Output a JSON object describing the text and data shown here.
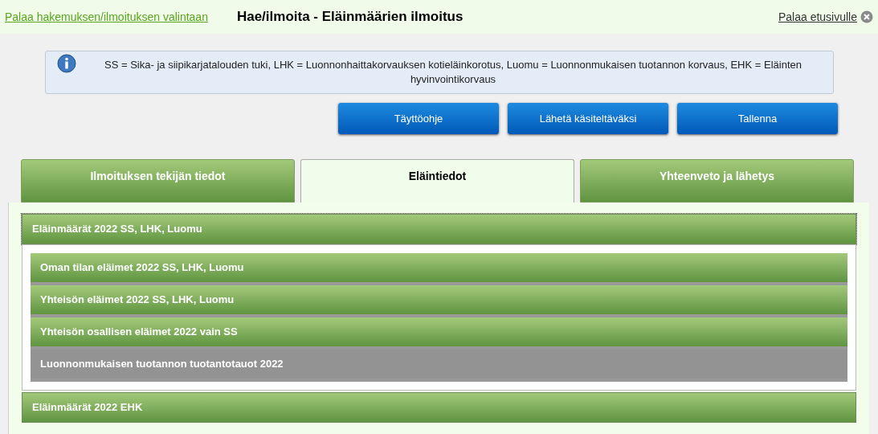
{
  "header": {
    "back_link": "Palaa hakemuksen/ilmoituksen valintaan",
    "title": "Hae/ilmoita - Eläinmäärien ilmoitus",
    "home_link": "Palaa etusivulle"
  },
  "info": {
    "text": "SS = Sika- ja siipikarjatalouden tuki, LHK = Luonnonhaittakorvauksen kotieläinkorotus, Luomu = Luonnonmukaisen tuotannon korvaus, EHK = Eläinten hyvinvointikorvaus"
  },
  "buttons": [
    "Täyttöohje",
    "Lähetä käsiteltäväksi",
    "Tallenna"
  ],
  "tabs": [
    {
      "label": "Ilmoituksen tekijän tiedot",
      "selected": false
    },
    {
      "label": "Eläintiedot",
      "selected": true
    },
    {
      "label": "Yhteenveto ja lähetys",
      "selected": false
    }
  ],
  "sections": [
    {
      "title": "Eläinmäärät 2022 SS, LHK, Luomu",
      "expanded": true,
      "items": [
        {
          "label": "Oman tilan eläimet 2022 SS, LHK, Luomu",
          "disabled": false
        },
        {
          "label": "Yhteisön eläimet 2022 SS, LHK, Luomu",
          "disabled": false
        },
        {
          "label": "Yhteisön osallisen eläimet 2022 vain SS",
          "disabled": false
        },
        {
          "label": "Luonnonmukaisen tuotannon tuotantotauot 2022",
          "disabled": true
        }
      ]
    },
    {
      "title": "Eläinmäärät 2022 EHK",
      "expanded": false
    }
  ]
}
